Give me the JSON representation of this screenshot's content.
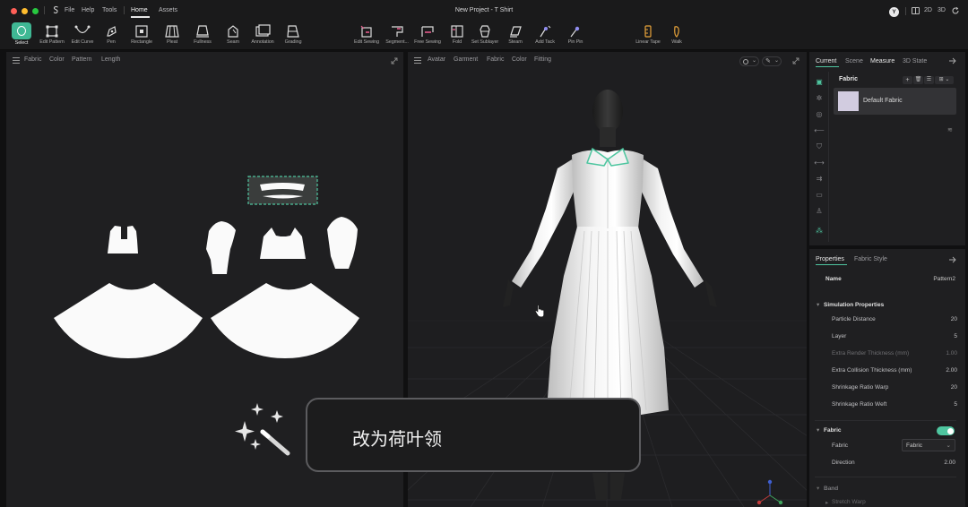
{
  "titlebar": {
    "menus": [
      "File",
      "Help",
      "Tools"
    ],
    "tabs": [
      "Home",
      "Assets"
    ],
    "active_tab": "Home",
    "project_title": "New Project - T Shirt",
    "user_initial": "Y",
    "view_modes": [
      "2D",
      "3D"
    ]
  },
  "toolbar": {
    "left_tools": [
      "Select",
      "Edit Pattern",
      "Edit Curve",
      "Pen",
      "Rectangle",
      "Pleat",
      "Fullness",
      "Seam",
      "Annotation",
      "Grading"
    ],
    "mid_tools": [
      "Edit Sewing",
      "Segment...",
      "Free Sewing",
      "Fold",
      "Set Sublayer",
      "Steam",
      "Add Tack",
      "Pin Pin"
    ],
    "right_tools": [
      "Linear Tape",
      "Walk"
    ]
  },
  "pattern_view": {
    "tabs": [
      "Fabric",
      "Color",
      "Pattern",
      "Length"
    ]
  },
  "avatar_view": {
    "tabs": [
      "Avatar",
      "Garment",
      "Fabric",
      "Color",
      "Fitting"
    ]
  },
  "object_panel": {
    "tabs": [
      "Current",
      "Scene",
      "Measure",
      "3D State"
    ],
    "active_tab": "Current",
    "section_title": "Fabric",
    "fabric_item": "Default Fabric",
    "swatch_color": "#d2cce0"
  },
  "properties": {
    "tabs": [
      "Properties",
      "Fabric Style"
    ],
    "name_label": "Name",
    "name_value": "Pattern2",
    "sim_header": "Simulation Properties",
    "rows": [
      {
        "label": "Particle Distance",
        "value": "20"
      },
      {
        "label": "Layer",
        "value": "5"
      },
      {
        "label": "Extra Render Thickness (mm)",
        "value": "1.00"
      },
      {
        "label": "Extra Collision Thickness (mm)",
        "value": "2.00"
      },
      {
        "label": "Shrinkage Ratio Warp",
        "value": "20"
      },
      {
        "label": "Shrinkage Ratio Weft",
        "value": "5"
      }
    ],
    "fabric_header": "Fabric",
    "fabric_label": "Fabric",
    "fabric_select": "Fabric",
    "direction_label": "Direction",
    "direction_value": "2.00",
    "band_header": "Band",
    "stretch_label": "Stretch Warp",
    "accent": "#4fc6a0"
  },
  "prompt": {
    "text": "改为荷叶领"
  }
}
